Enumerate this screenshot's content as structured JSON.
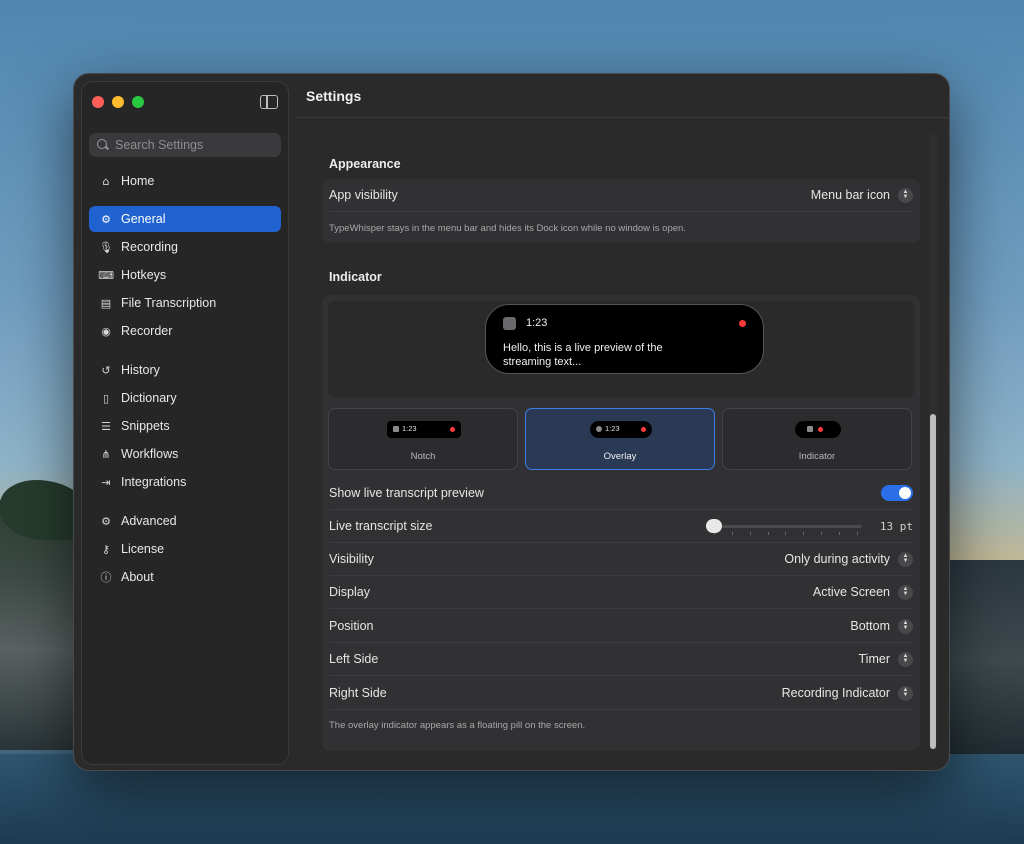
{
  "window": {
    "title": "Settings"
  },
  "sidebar": {
    "search_placeholder": "Search Settings",
    "items": [
      {
        "label": "Home",
        "icon": "house-icon"
      },
      {
        "label": "General",
        "icon": "gear-icon",
        "active": true
      },
      {
        "label": "Recording",
        "icon": "microphone-icon"
      },
      {
        "label": "Hotkeys",
        "icon": "keyboard-icon"
      },
      {
        "label": "File Transcription",
        "icon": "document-icon"
      },
      {
        "label": "Recorder",
        "icon": "recorder-icon"
      },
      {
        "label": "History",
        "icon": "history-icon"
      },
      {
        "label": "Dictionary",
        "icon": "book-icon"
      },
      {
        "label": "Snippets",
        "icon": "snippets-icon"
      },
      {
        "label": "Workflows",
        "icon": "workflow-icon"
      },
      {
        "label": "Integrations",
        "icon": "integrations-icon"
      },
      {
        "label": "Advanced",
        "icon": "gears-icon"
      },
      {
        "label": "License",
        "icon": "key-icon"
      },
      {
        "label": "About",
        "icon": "info-icon"
      }
    ]
  },
  "appearance": {
    "title": "Appearance",
    "app_visibility_label": "App visibility",
    "app_visibility_value": "Menu bar icon",
    "note": "TypeWhisper stays in the menu bar and hides its Dock icon while no window is open."
  },
  "indicator": {
    "title": "Indicator",
    "preview": {
      "time": "1:23",
      "text": "Hello, this is a live preview of the streaming text..."
    },
    "styles": [
      {
        "label": "Notch",
        "time": "1:23",
        "selected": false
      },
      {
        "label": "Overlay",
        "time": "1:23",
        "selected": true
      },
      {
        "label": "Indicator",
        "selected": false
      }
    ],
    "show_preview_label": "Show live transcript preview",
    "show_preview_on": true,
    "size_label": "Live transcript size",
    "size_value": "13 pt",
    "visibility_label": "Visibility",
    "visibility_value": "Only during activity",
    "display_label": "Display",
    "display_value": "Active Screen",
    "position_label": "Position",
    "position_value": "Bottom",
    "left_label": "Left Side",
    "left_value": "Timer",
    "right_label": "Right Side",
    "right_value": "Recording Indicator",
    "note": "The overlay indicator appears as a floating pill on the screen."
  },
  "colors": {
    "accent": "#1f62d0",
    "toggle_on": "#2a6ee8",
    "recording_dot": "#ff3b3b"
  }
}
